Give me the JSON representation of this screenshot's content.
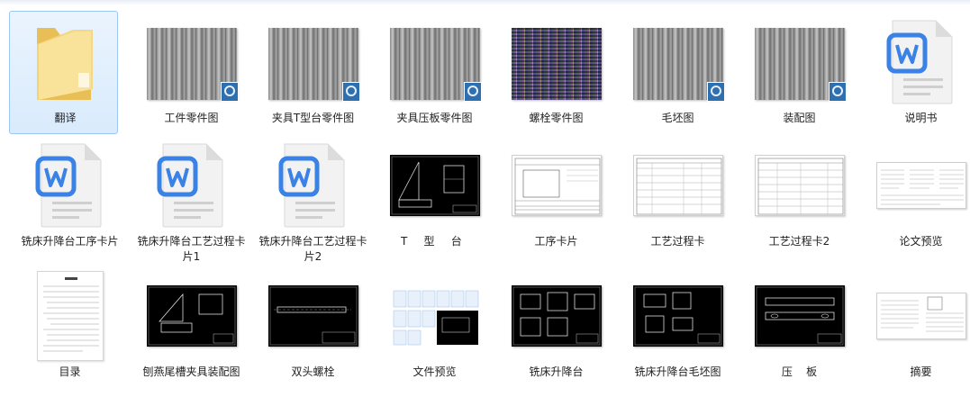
{
  "items": [
    {
      "label": "翻译",
      "icon": "folder-icon",
      "selected": true
    },
    {
      "label": "工件零件图",
      "icon": "image-file-icon"
    },
    {
      "label": "夹具T型台零件图",
      "icon": "image-file-icon"
    },
    {
      "label": "夹具压板零件图",
      "icon": "image-file-icon"
    },
    {
      "label": "螺栓零件图",
      "icon": "image-file-icon"
    },
    {
      "label": "毛坯图",
      "icon": "image-file-icon"
    },
    {
      "label": "装配图",
      "icon": "image-file-icon"
    },
    {
      "label": "说明书",
      "icon": "word-document-icon"
    },
    {
      "label": "铣床升降台工序卡片",
      "icon": "word-document-icon"
    },
    {
      "label": "铣床升降台工艺过程卡片1",
      "icon": "word-document-icon"
    },
    {
      "label": "铣床升降台工艺过程卡片2",
      "icon": "word-document-icon"
    },
    {
      "label": "T 型 台",
      "icon": "cad-drawing-thumbnail"
    },
    {
      "label": "工序卡片",
      "icon": "form-thumbnail"
    },
    {
      "label": "工艺过程卡",
      "icon": "form-thumbnail"
    },
    {
      "label": "工艺过程卡2",
      "icon": "form-thumbnail"
    },
    {
      "label": "论文预览",
      "icon": "document-pages-thumbnail"
    },
    {
      "label": "目录",
      "icon": "document-page-thumbnail"
    },
    {
      "label": "刨燕尾槽夹具装配图",
      "icon": "cad-drawing-thumbnail"
    },
    {
      "label": "双头螺栓",
      "icon": "cad-drawing-thumbnail"
    },
    {
      "label": "文件预览",
      "icon": "preview-thumbnail"
    },
    {
      "label": "铣床升降台",
      "icon": "cad-drawing-thumbnail"
    },
    {
      "label": "铣床升降台毛坯图",
      "icon": "cad-drawing-thumbnail"
    },
    {
      "label": "压    板",
      "icon": "cad-drawing-thumbnail"
    },
    {
      "label": "摘要",
      "icon": "document-pages-thumbnail"
    }
  ],
  "colors": {
    "selection_bg": "#d9ebfc",
    "selection_border": "#9dc7f1",
    "word_blue": "#3a82e6",
    "folder_yellow": "#f5d57a"
  }
}
